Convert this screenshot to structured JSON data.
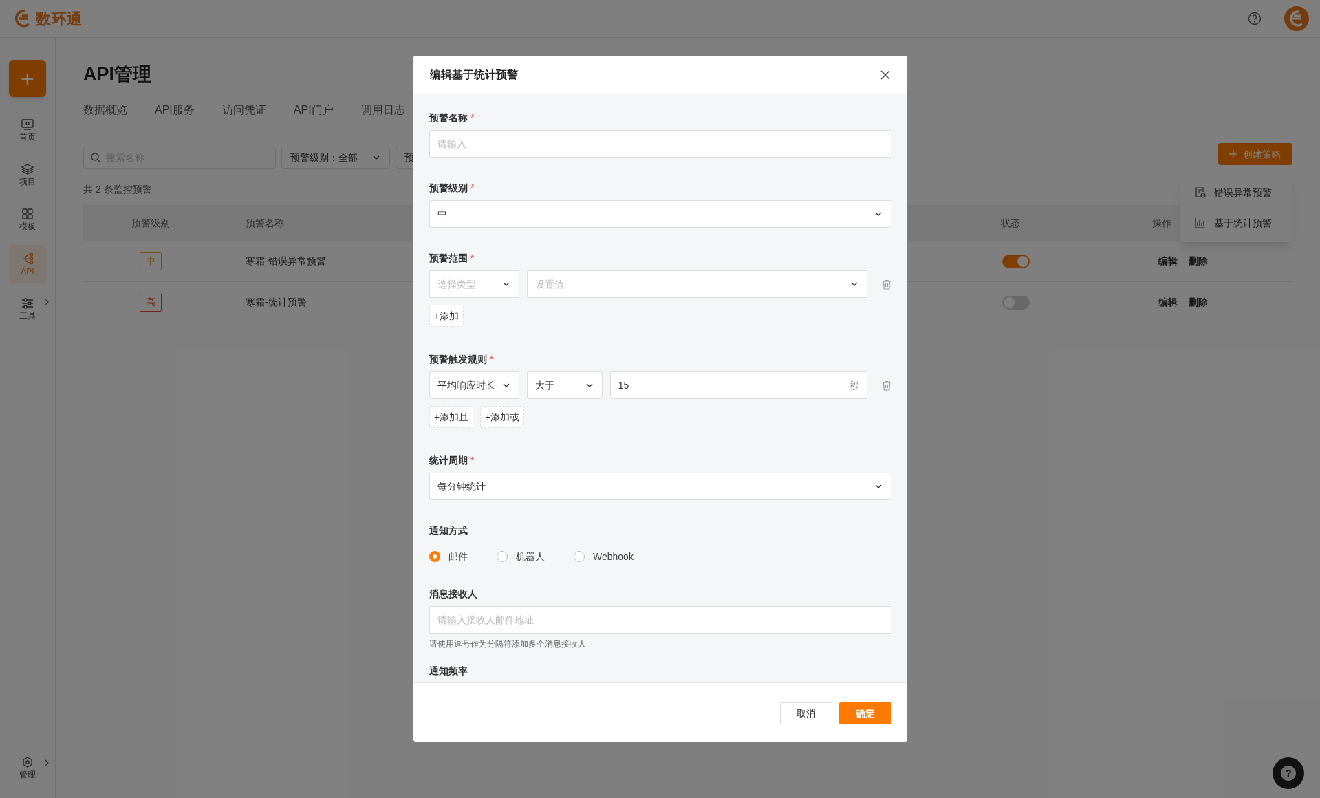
{
  "header": {
    "logo_text": "数环通"
  },
  "sidebar": {
    "create_button": "+",
    "items": [
      {
        "kind": "home",
        "label": "首页",
        "selected": false,
        "submenu": false
      },
      {
        "kind": "project",
        "label": "项目",
        "selected": false,
        "submenu": false
      },
      {
        "kind": "template",
        "label": "模板",
        "selected": false,
        "submenu": false
      },
      {
        "kind": "api",
        "label": "API",
        "selected": true,
        "submenu": false
      },
      {
        "kind": "tools",
        "label": "工具",
        "selected": false,
        "submenu": true
      }
    ],
    "bottom_item": {
      "label": "管理",
      "submenu": true
    }
  },
  "page": {
    "title": "API管理",
    "tabs": [
      "数据概览",
      "API服务",
      "访问凭证",
      "API门户",
      "调用日志"
    ],
    "search": {
      "placeholder": "搜索名称"
    },
    "filters": [
      "预警级别：全部",
      "预"
    ],
    "count_text": "共 2 条监控预警",
    "create_button": "创建策略",
    "create_menu": [
      {
        "kind": "error",
        "label": "错误异常预警"
      },
      {
        "kind": "stats",
        "label": "基于统计预警"
      }
    ],
    "table": {
      "columns": [
        "预警级别",
        "预警名称",
        "状态",
        "操作"
      ],
      "rows": [
        {
          "level": "中",
          "kind": "medium",
          "name": "寒霜-错误异常预警",
          "on": true,
          "actions": [
            "编辑",
            "删除"
          ]
        },
        {
          "level": "高",
          "kind": "high",
          "name": "寒霜-统计预警",
          "on": false,
          "actions": [
            "编辑",
            "删除"
          ]
        }
      ]
    }
  },
  "dialog": {
    "title": "编辑基于统计预警",
    "fields": [
      {
        "kind": "input",
        "label": "预警名称",
        "required_mark": "*",
        "placeholder": "请输入"
      },
      {
        "kind": "select",
        "label": "预警级别",
        "required_mark": "*",
        "value": "中"
      },
      {
        "kind": "scope",
        "label": "预警范围",
        "required_mark": "*",
        "type_placeholder": "选择类型",
        "value_placeholder": "设置值",
        "buttons": [
          "+添加"
        ]
      },
      {
        "kind": "rule",
        "label": "预警触发规则",
        "required_mark": "*",
        "metric": "平均响应时长",
        "operator": "大于",
        "threshold": "15",
        "unit": "秒",
        "buttons": [
          "+添加且",
          "+添加或"
        ]
      },
      {
        "kind": "select",
        "label": "统计周期",
        "required_mark": "*",
        "value": "每分钟统计"
      },
      {
        "kind": "radio",
        "label": "通知方式",
        "options": [
          {
            "label": "邮件",
            "selected": true
          },
          {
            "label": "机器人",
            "selected": false
          },
          {
            "label": "Webhook",
            "selected": false
          }
        ]
      },
      {
        "kind": "input",
        "label": "消息接收人",
        "placeholder": "请输入接收人邮件地址",
        "hint": "请使用逗号作为分隔符添加多个消息接收人"
      },
      {
        "kind": "heading",
        "label": "通知频率"
      }
    ],
    "buttons": {
      "cancel": "取消",
      "ok": "确定"
    }
  },
  "help_button": "?"
}
